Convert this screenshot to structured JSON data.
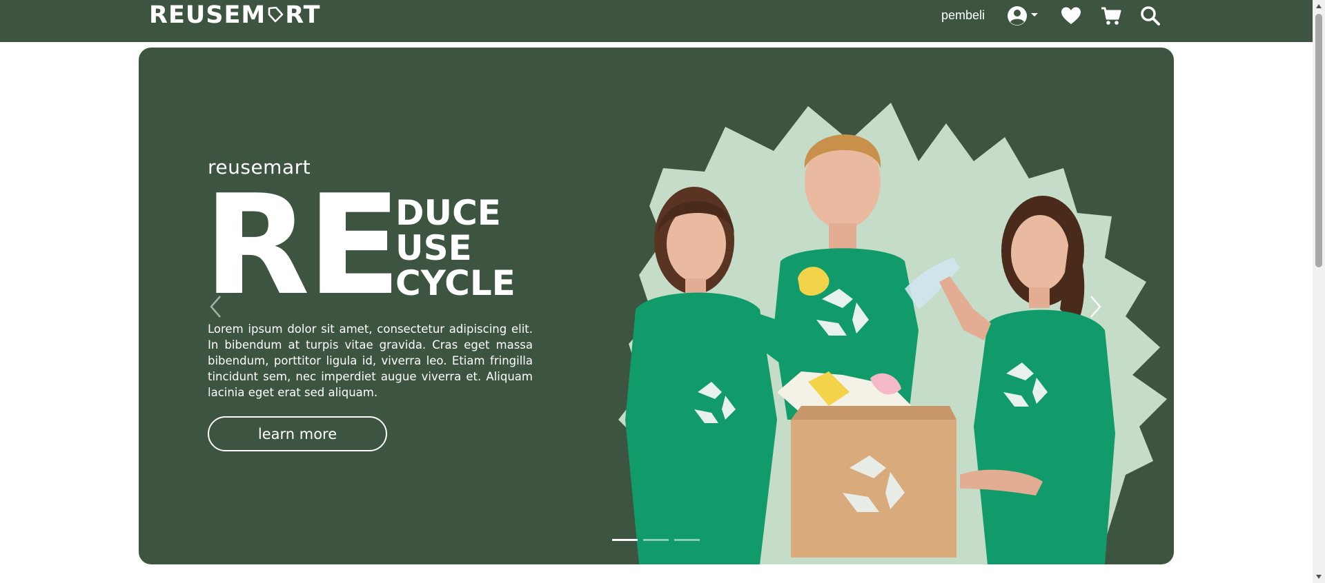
{
  "navbar": {
    "logo": "REUSEM♡RT",
    "logo_left": "REUSEM",
    "logo_right": "RT",
    "username": "pembeli",
    "icons": [
      "account-icon",
      "heart-icon",
      "cart-icon",
      "search-icon"
    ]
  },
  "hero": {
    "brand": "reusemart",
    "big_text": "RE",
    "words": [
      "DUCE",
      "USE",
      "CYCLE"
    ],
    "description": "Lorem ipsum dolor sit amet, consectetur adipiscing elit. In bibendum at turpis vitae gravida. Cras eget massa bibendum, porttitor ligula id, viverra leo. Etiam fringilla tincidunt sem, nec imperdiet augue viverra et. Aliquam lacinia eget erat sed aliquam.",
    "button_label": "learn more",
    "slides": 3,
    "active_slide": 1
  },
  "colors": {
    "primary": "#3d5441",
    "burst": "#c5dcc8",
    "shirt": "#119a6a",
    "white": "#ffffff"
  }
}
